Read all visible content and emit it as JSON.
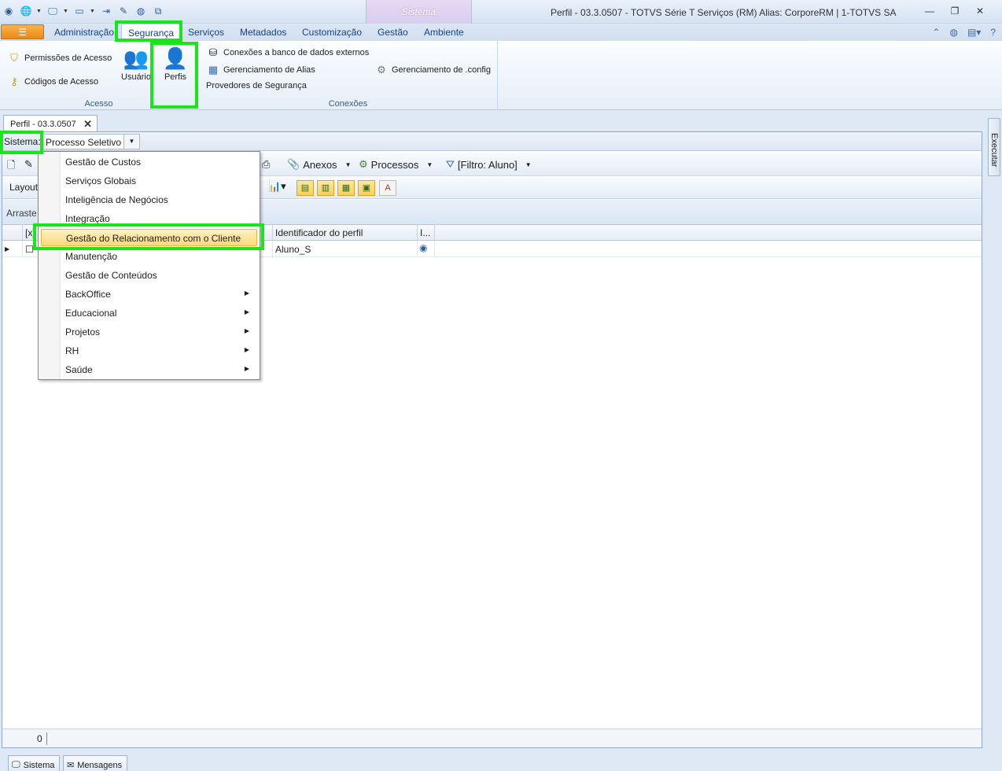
{
  "window": {
    "title": "Perfil - 03.3.0507 - TOTVS Série T Serviços (RM) Alias: CorporeRM | 1-TOTVS SA",
    "context_tab": "Sistema"
  },
  "ribbon": {
    "tabs": [
      "Administração",
      "Segurança",
      "Serviços",
      "Metadados",
      "Customização",
      "Gestão",
      "Ambiente"
    ],
    "active_tab": "Segurança",
    "groups": {
      "acesso": {
        "label": "Acesso",
        "permissoes": "Permissões de Acesso",
        "codigos": "Códigos de Acesso",
        "usuarios": "Usuário",
        "perfis": "Perfis"
      },
      "conexoes": {
        "label": "Conexões",
        "banco": "Conexões a banco de dados externos",
        "alias": "Gerenciamento de Alias",
        "provedores": "Provedores de Segurança",
        "config": "Gerenciamento de .config"
      }
    }
  },
  "document": {
    "tab_label": "Perfil - 03.3.0507",
    "sistema_label": "Sistema:",
    "sistema_value": "Processo Seletivo",
    "toolbar": {
      "anexos": "Anexos",
      "processos": "Processos",
      "filtro": "[Filtro: Aluno]",
      "layout": "Layout"
    },
    "group_panel_text": "Arraste a",
    "grid": {
      "headers": [
        "[x]",
        "Identificador do perfil",
        "I..."
      ],
      "rows": [
        {
          "id": "Aluno_S"
        }
      ]
    },
    "record_count": "0"
  },
  "side_panel": {
    "label": "Executar"
  },
  "sistema_dropdown": {
    "items": [
      {
        "label": "Gestão de Custos",
        "submenu": false
      },
      {
        "label": "Serviços Globais",
        "submenu": false
      },
      {
        "label": "Inteligência de Negócios",
        "submenu": false
      },
      {
        "label": "Integração",
        "submenu": false
      },
      {
        "label": "Gestão do Relacionamento com o Cliente",
        "submenu": false,
        "selected": true
      },
      {
        "label": "Manutenção",
        "submenu": false
      },
      {
        "label": "Gestão de Conteúdos",
        "submenu": false
      },
      {
        "label": "BackOffice",
        "submenu": true
      },
      {
        "label": "Educacional",
        "submenu": true
      },
      {
        "label": "Projetos",
        "submenu": true
      },
      {
        "label": "RH",
        "submenu": true
      },
      {
        "label": "Saúde",
        "submenu": true
      }
    ]
  },
  "statusbar": {
    "sistema": "Sistema",
    "mensagens": "Mensagens"
  },
  "colors": {
    "highlight": "#19e619",
    "app_button": "#ea8a14",
    "ribbon_text": "#15428b"
  }
}
